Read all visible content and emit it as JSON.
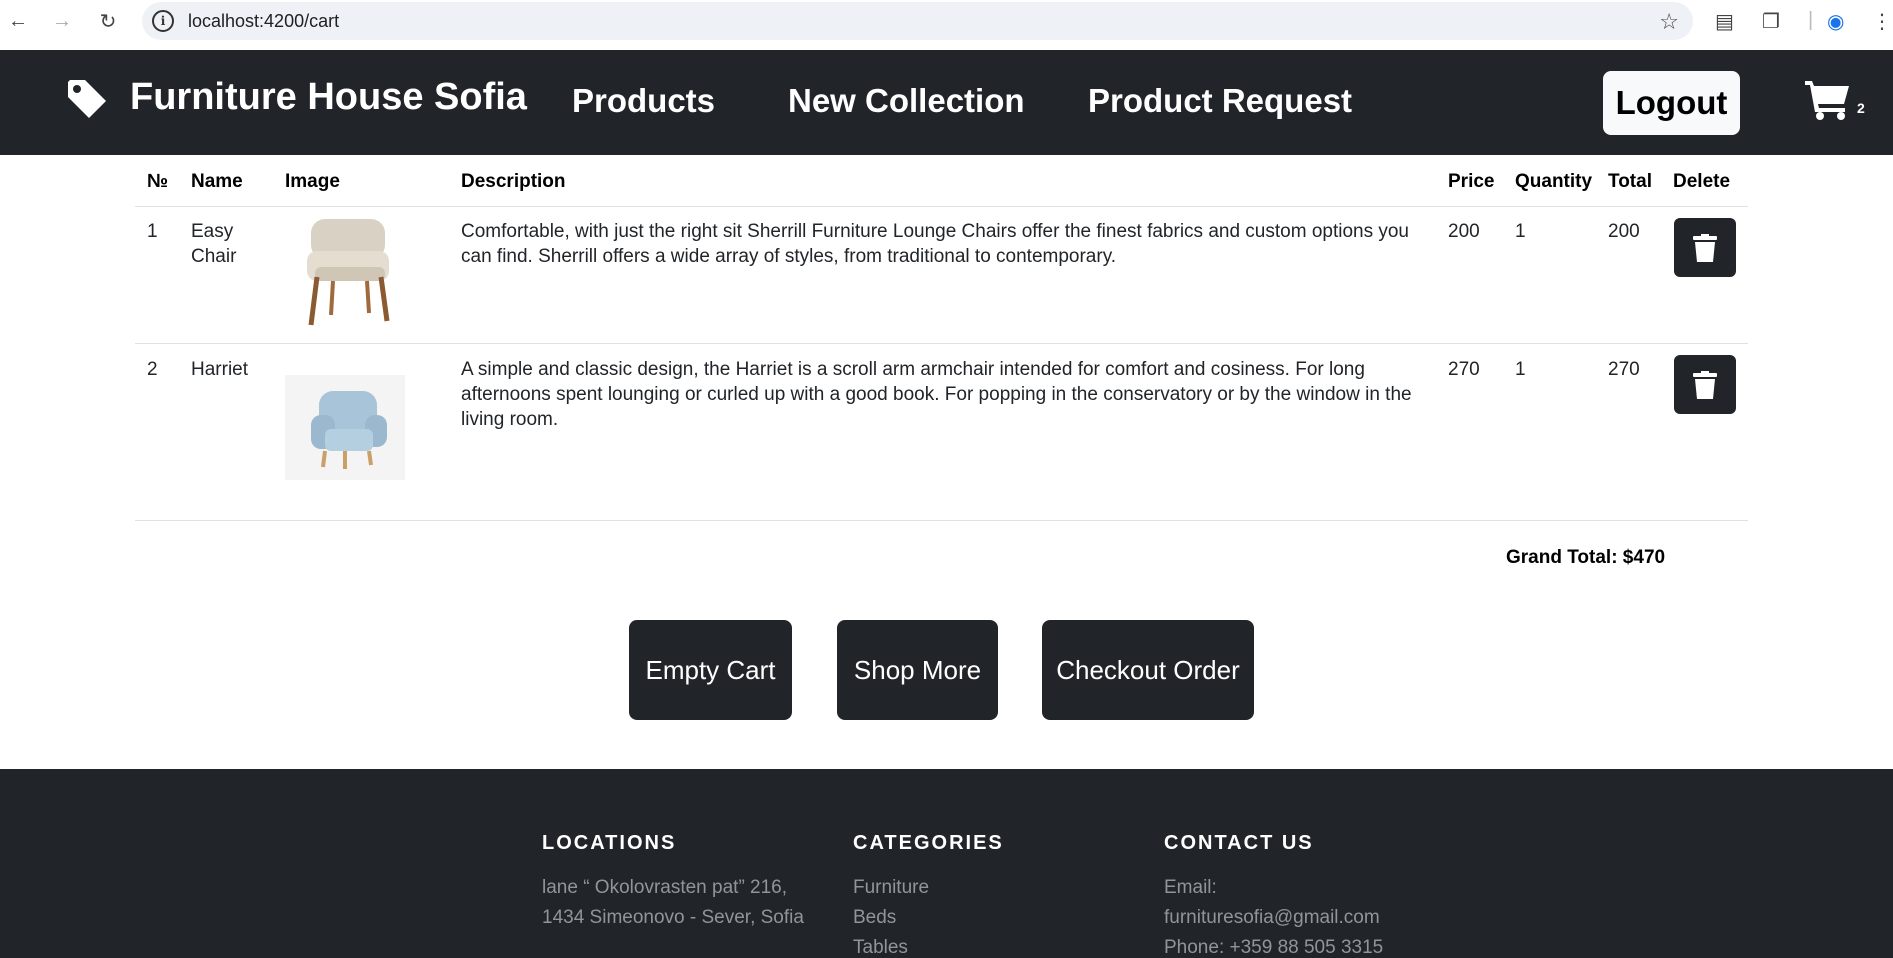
{
  "browser": {
    "url": "localhost:4200/cart"
  },
  "navbar": {
    "brand": "Furniture House Sofia",
    "links": [
      "Products",
      "New Collection",
      "Product Request"
    ],
    "logout_label": "Logout",
    "cart_count": "2"
  },
  "table": {
    "headers": [
      "№",
      "Name",
      "Image",
      "Description",
      "Price",
      "Quantity",
      "Total",
      "Delete"
    ],
    "rows": [
      {
        "index": "1",
        "name": "Easy Chair",
        "image": "beige-armchair-image",
        "description": "Comfortable, with just the right sit Sherrill Furniture Lounge Chairs offer the finest fabrics and custom options you can find. Sherrill offers a wide array of styles, from traditional to contemporary.",
        "price": "200",
        "quantity": "1",
        "total": "200"
      },
      {
        "index": "2",
        "name": "Harriet",
        "image": "light-blue-armchair-image",
        "description": "A simple and classic design, the Harriet is a scroll arm armchair intended for comfort and cosiness. For long afternoons spent lounging or curled up with a good book. For popping in the conservatory or by the window in the living room.",
        "price": "270",
        "quantity": "1",
        "total": "270"
      }
    ]
  },
  "summary": {
    "grand_total": "Grand Total: $470"
  },
  "actions": {
    "empty_cart": "Empty Cart",
    "shop_more": "Shop More",
    "checkout": "Checkout Order"
  },
  "footer": {
    "locations": {
      "title": "LOCATIONS",
      "lines": [
        "lane “ Okolovrasten pat” 216,",
        "1434 Simeonovo - Sever, Sofia"
      ]
    },
    "categories": {
      "title": "CATEGORIES",
      "items": [
        "Furniture",
        "Beds",
        "Tables"
      ]
    },
    "contact": {
      "title": "CONTACT US",
      "lines": [
        "Email:",
        "furnituresofia@gmail.com",
        "Phone: +359 88 505 3315"
      ]
    }
  },
  "colors": {
    "dark": "#212529",
    "light_button": "#f8f9fa",
    "footer_text": "#8f959a"
  }
}
